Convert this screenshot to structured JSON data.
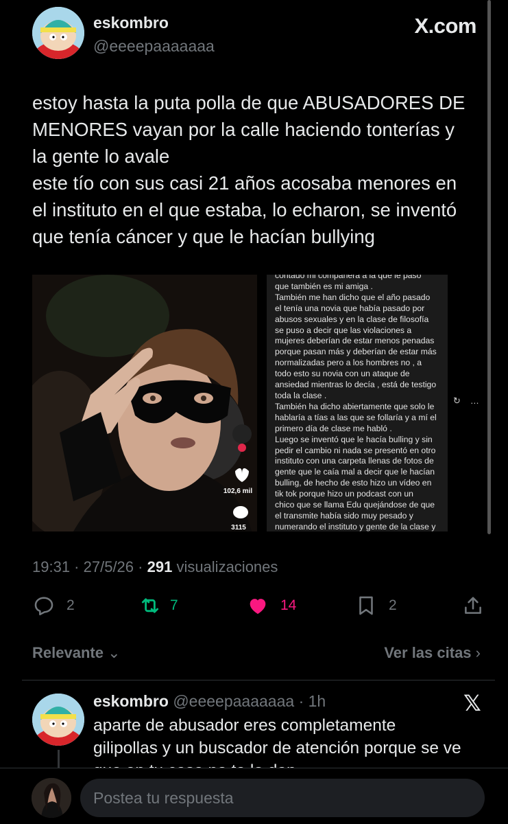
{
  "header": {
    "display_name": "eskombro",
    "handle": "@eeeepaaaaaaa",
    "brand": "X.com"
  },
  "tweet": {
    "lines": [
      "estoy hasta la puta polla de que ABUSADORES DE",
      "MENORES vayan por la calle haciendo tonterías y",
      "la gente lo avale",
      "este tío con sus casi 21 años acosaba menores en",
      "el instituto en el que estaba, lo echaron, se inventó",
      "que tenía cáncer y que le hacían bullying"
    ]
  },
  "media": {
    "video_likes": "102,6 mil",
    "video_comments": "3115",
    "screenshot_lines": [
      "contado mi compañera a la que le pasó",
      "que también es mi amiga .",
      "También me han dicho que el año pasado",
      "el tenía una novia que había pasado por",
      "abusos sexuales y en la clase de filosofía",
      "se puso a decir que las violaciones a",
      "mujeres deberían de estar menos penadas",
      "porque pasan más y deberían de estar más",
      "normalizadas pero a los hombres no , a",
      "todo esto su novia con un ataque de",
      "ansiedad mientras lo decía , está de testigo",
      "toda la clase .",
      "También ha dicho abiertamente que solo le",
      "hablaría a tías a las que se follaría y a mí el",
      "primero día de clase me habló .",
      "Luego se inventó que le hacía bulling y sin",
      "pedir el cambio ni nada se presentó en otro",
      "instituto con una carpeta llenas de fotos de",
      "gente que le caía mal a decir que le hacían",
      "bulling, de hecho de esto hizo un vídeo en",
      "tik tok porque hizo un podcast con un",
      "chico que se llama Edu quejándose de que",
      "el transmite había sido muy pesado y",
      "numerando el instituto y gente de la clase y"
    ],
    "pane_icons": [
      "↻",
      "…"
    ]
  },
  "meta": {
    "time": "19:31",
    "date": "27/5/26",
    "views": "291",
    "views_label": "visualizaciones"
  },
  "actions": {
    "replies": "2",
    "reposts": "7",
    "likes": "14",
    "bookmarks": "2"
  },
  "colors": {
    "like": "#f91880",
    "repost": "#00ba7c",
    "muted": "#71767b"
  },
  "filters": {
    "sort_label": "Relevante",
    "quotes_label": "Ver las citas"
  },
  "reply": {
    "display_name": "eskombro",
    "handle": "@eeeepaaaaaaa",
    "time": "1h",
    "lines": [
      "aparte de abusador eres completamente",
      "gilipollas y un buscador de atención porque se ve",
      "que en tu casa no te lo dan"
    ]
  },
  "composer": {
    "placeholder": "Postea tu respuesta"
  }
}
